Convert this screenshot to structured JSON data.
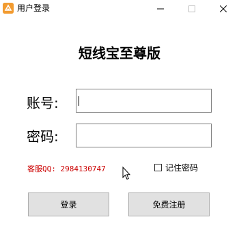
{
  "window": {
    "title": "用户登录",
    "controls": {
      "minimize": "minimize-icon",
      "maximize": "maximize-icon",
      "close": "close-icon"
    }
  },
  "heading": "短线宝至尊版",
  "form": {
    "account_label": "账号:",
    "account_value": "",
    "password_label": "密码:",
    "password_value": ""
  },
  "service": "客服QQ: 2984130747",
  "remember": {
    "label": "记住密码",
    "checked": false
  },
  "buttons": {
    "login": "登录",
    "register": "免费注册"
  },
  "colors": {
    "service_text": "#cc0000",
    "app_icon": "#f29b30",
    "button_bg": "#e1e1e1"
  }
}
